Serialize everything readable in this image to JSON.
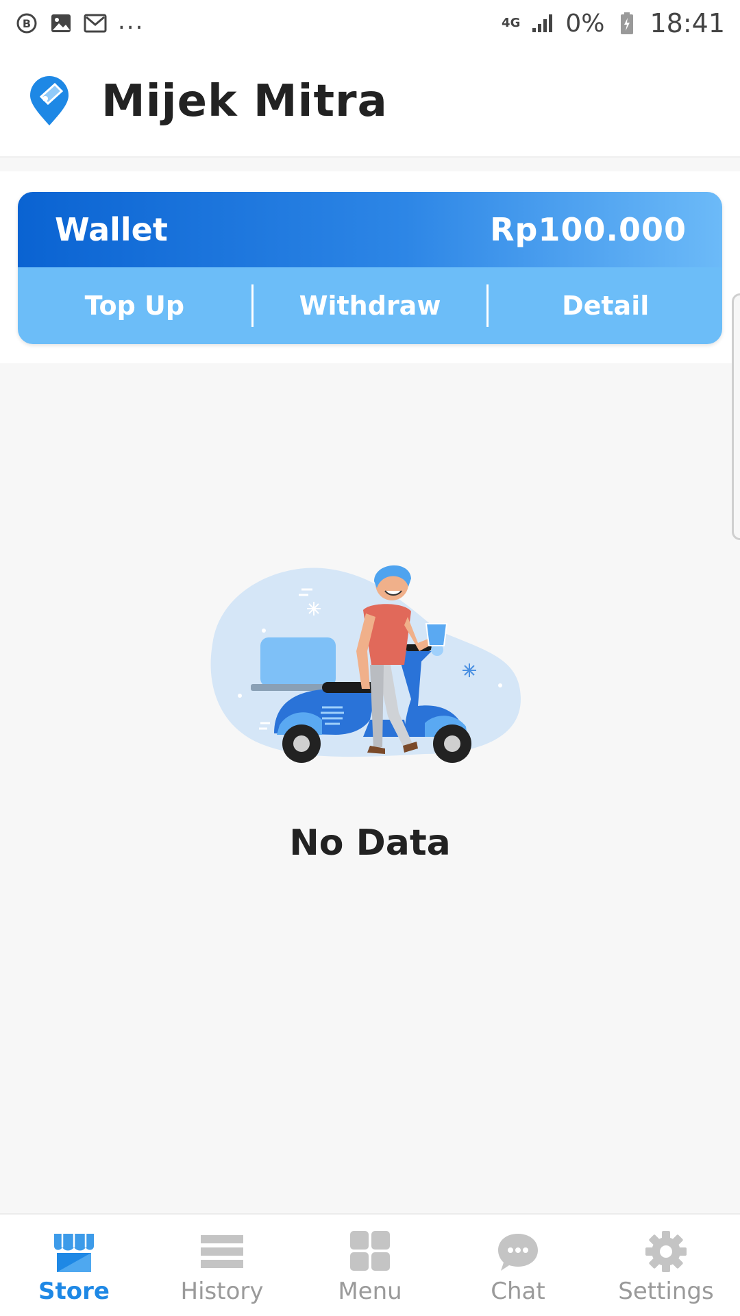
{
  "status_bar": {
    "left_icons": [
      "b-icon",
      "image-icon",
      "gmail-icon"
    ],
    "overflow": "...",
    "network": "4G",
    "battery": "0%",
    "time": "18:41"
  },
  "app": {
    "title": "Mijek Mitra",
    "logo_icon": "map-pin-logo-icon"
  },
  "wallet": {
    "label": "Wallet",
    "balance": "Rp100.000",
    "actions": [
      "Top Up",
      "Withdraw",
      "Detail"
    ]
  },
  "empty_state": {
    "illustration": "scooter-rider-illustration",
    "text": "No Data"
  },
  "bottom_nav": {
    "items": [
      {
        "label": "Store",
        "icon": "store-icon",
        "active": true
      },
      {
        "label": "History",
        "icon": "list-icon",
        "active": false
      },
      {
        "label": "Menu",
        "icon": "grid-icon",
        "active": false
      },
      {
        "label": "Chat",
        "icon": "chat-bubble-icon",
        "active": false
      },
      {
        "label": "Settings",
        "icon": "gear-icon",
        "active": false
      }
    ]
  },
  "colors": {
    "accent": "#1e88e5",
    "wallet_gradient_start": "#0a63d2",
    "wallet_gradient_end": "#6cbaf8",
    "wallet_actions_bg": "#6cbdf8",
    "inactive_nav": "#9a9a9a"
  }
}
